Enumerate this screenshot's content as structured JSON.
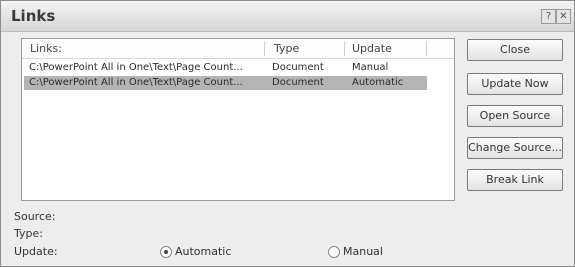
{
  "dialog": {
    "title": "Links"
  },
  "titlebar": {
    "help_glyph": "?",
    "close_glyph": "✕"
  },
  "list": {
    "columns": [
      "Links:",
      "Type",
      "Update"
    ],
    "rows": [
      {
        "link": "C:\\PowerPoint All in One\\Text\\Page Count...",
        "type": "Document",
        "update": "Manual"
      },
      {
        "link": "C:\\PowerPoint All in One\\Text\\Page Count...",
        "type": "Document",
        "update": "Automatic"
      }
    ],
    "selected_row": 1
  },
  "buttons": {
    "close": "Close",
    "update_now": "Update Now",
    "open_source": "Open Source",
    "change_source": "Change Source...",
    "break_link": "Break Link"
  },
  "details": {
    "source_label": "Source:",
    "type_label": "Type:",
    "update_label": "Update:",
    "automatic": "Automatic",
    "manual": "Manual",
    "selected_update": "Automatic"
  }
}
